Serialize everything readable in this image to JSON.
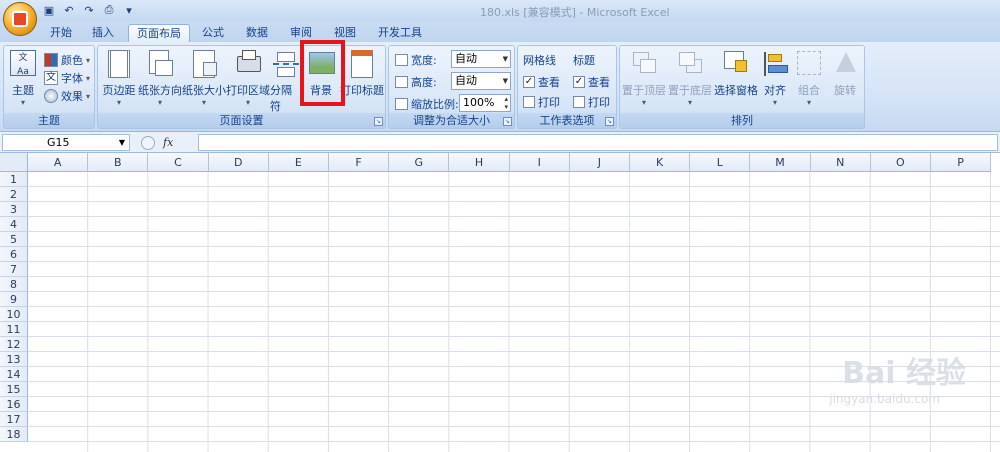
{
  "window": {
    "title": "180.xls  [兼容模式] - Microsoft Excel"
  },
  "tabs": [
    "开始",
    "插入",
    "页面布局",
    "公式",
    "数据",
    "审阅",
    "视图",
    "开发工具"
  ],
  "ribbon": {
    "theme_group": {
      "label": "主题",
      "theme_btn": "主题",
      "colors": "颜色",
      "fonts": "字体",
      "effects": "效果"
    },
    "page_setup": {
      "label": "页面设置",
      "margins": "页边距",
      "orientation": "纸张方向",
      "size": "纸张大小",
      "print_area": "打印区域",
      "breaks": "分隔符",
      "background": "背景",
      "print_titles": "打印标题"
    },
    "scale": {
      "label": "调整为合适大小",
      "width_label": "宽度:",
      "width_value": "自动",
      "height_label": "高度:",
      "height_value": "自动",
      "scale_label": "缩放比例:",
      "scale_value": "100%"
    },
    "sheet_options": {
      "label": "工作表选项",
      "gridlines": "网格线",
      "headings": "标题",
      "view": "查看",
      "print": "打印",
      "gridlines_view": true,
      "headings_view": true
    },
    "arrange": {
      "label": "排列",
      "bring_front": "置于顶层",
      "send_back": "置于底层",
      "selection_pane": "选择窗格",
      "align": "对齐",
      "group": "组合",
      "rotate": "旋转"
    }
  },
  "formula_bar": {
    "name_box": "G15",
    "fx": "fx",
    "content": ""
  },
  "columns": [
    "A",
    "B",
    "C",
    "D",
    "E",
    "F",
    "G",
    "H",
    "I",
    "J",
    "K",
    "L",
    "M",
    "N",
    "O",
    "P"
  ],
  "rows": [
    "1",
    "2",
    "3",
    "4",
    "5",
    "6",
    "7",
    "8",
    "9",
    "10",
    "11",
    "12",
    "13",
    "14",
    "15",
    "16",
    "17",
    "18"
  ],
  "watermark": {
    "brand": "Bai 经验",
    "url": "jingyan.baidu.com"
  }
}
